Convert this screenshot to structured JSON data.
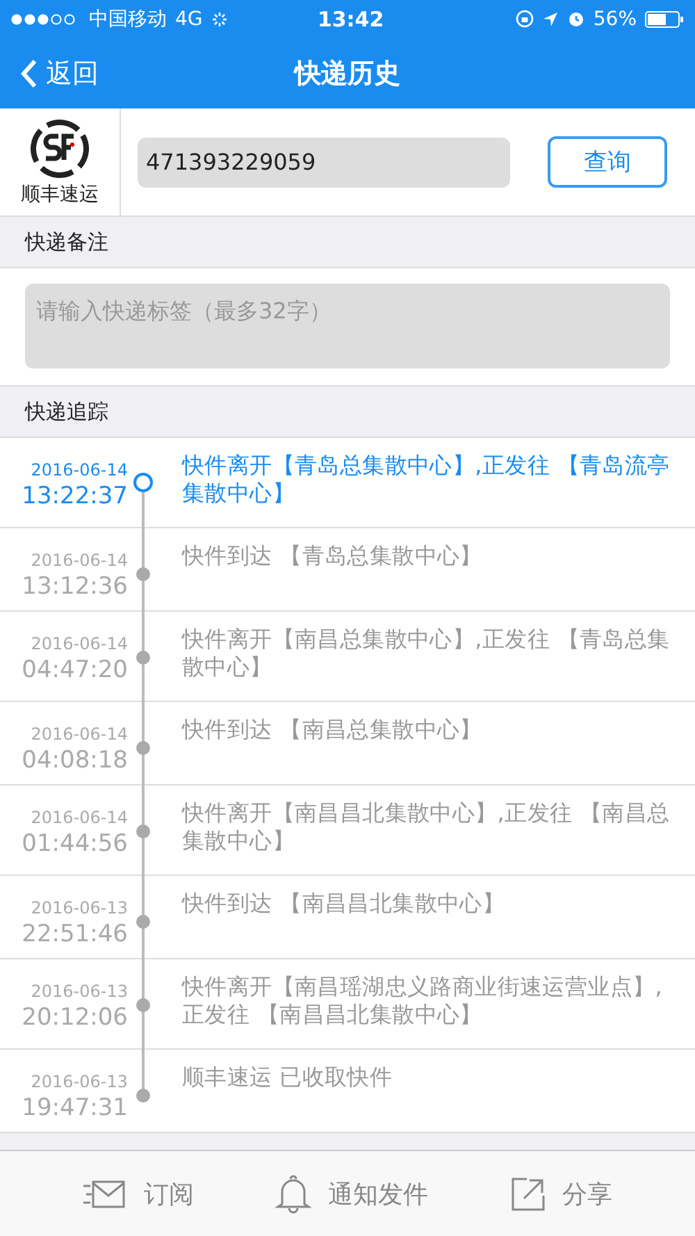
{
  "status_bar": {
    "carrier": "中国移动",
    "network": "4G",
    "time": "13:42",
    "battery": "56%"
  },
  "nav": {
    "back": "返回",
    "title": "快递历史"
  },
  "query": {
    "company": "顺丰速运",
    "tracking_number": "471393229059",
    "button": "查询"
  },
  "note": {
    "title": "快递备注",
    "placeholder": "请输入快递标签（最多32字）"
  },
  "tracking": {
    "title": "快递追踪",
    "events": [
      {
        "date": "2016-06-14",
        "time": "13:22:37",
        "text": "快件离开【青岛总集散中心】,正发往 【青岛流亭集散中心】",
        "current": true
      },
      {
        "date": "2016-06-14",
        "time": "13:12:36",
        "text": "快件到达 【青岛总集散中心】",
        "current": false
      },
      {
        "date": "2016-06-14",
        "time": "04:47:20",
        "text": "快件离开【南昌总集散中心】,正发往 【青岛总集散中心】",
        "current": false
      },
      {
        "date": "2016-06-14",
        "time": "04:08:18",
        "text": "快件到达 【南昌总集散中心】",
        "current": false
      },
      {
        "date": "2016-06-14",
        "time": "01:44:56",
        "text": "快件离开【南昌昌北集散中心】,正发往 【南昌总集散中心】",
        "current": false
      },
      {
        "date": "2016-06-13",
        "time": "22:51:46",
        "text": "快件到达 【南昌昌北集散中心】",
        "current": false
      },
      {
        "date": "2016-06-13",
        "time": "20:12:06",
        "text": "快件离开【南昌瑶湖忠义路商业街速运营业点】,正发往 【南昌昌北集散中心】",
        "current": false
      },
      {
        "date": "2016-06-13",
        "time": "19:47:31",
        "text": "顺丰速运 已收取快件",
        "current": false
      }
    ]
  },
  "toolbar": [
    {
      "kind": "subscribe",
      "label": "订阅"
    },
    {
      "kind": "notify",
      "label": "通知发件"
    },
    {
      "kind": "share",
      "label": "分享"
    }
  ]
}
